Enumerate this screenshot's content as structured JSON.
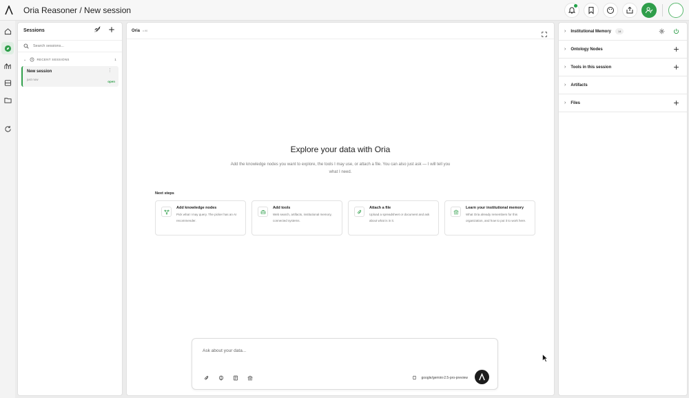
{
  "header": {
    "title": "Oria Reasoner / New session"
  },
  "colors": {
    "accent": "#2f9e4a",
    "text": "#1c1c1c",
    "muted": "#777777"
  },
  "rail": {
    "items": [
      "home-icon",
      "compass-icon",
      "chart-icon",
      "database-icon",
      "folder-icon",
      "refresh-icon"
    ]
  },
  "sessions": {
    "title": "Sessions",
    "search_placeholder": "Search sessions...",
    "recent_label": "RECENT SESSIONS",
    "recent_count": "1",
    "items": [
      {
        "name": "New session",
        "time": "just now",
        "status": "open"
      }
    ]
  },
  "main": {
    "agent_name": "Oria",
    "agent_version": "v.90",
    "hero_title": "Explore your data with Oria",
    "hero_subtitle": "Add the knowledge nodes you want to explore, the tools I may use, or attach a file. You can also just ask — I will tell you what I need.",
    "next_steps_label": "Next steps",
    "cards": [
      {
        "title": "Add knowledge nodes",
        "desc": "Pick what I may query. The picker has an AI recommender."
      },
      {
        "title": "Add tools",
        "desc": "Web search, artifacts, institutional memory, connected systems."
      },
      {
        "title": "Attach a file",
        "desc": "Upload a spreadsheet or document and ask about what is in it."
      },
      {
        "title": "Learn your institutional memory",
        "desc": "What Oria already remembers for this organization, and how to put it to work here."
      }
    ],
    "composer_placeholder": "Ask about your data...",
    "model_name": "google/gemini-2.5-pro-preview"
  },
  "right_panel": {
    "rows": [
      {
        "title": "Institutional Memory",
        "badge": "14"
      },
      {
        "title": "Ontology Nodes"
      },
      {
        "title": "Tools in this session"
      },
      {
        "title": "Artifacts"
      },
      {
        "title": "Files"
      }
    ]
  }
}
